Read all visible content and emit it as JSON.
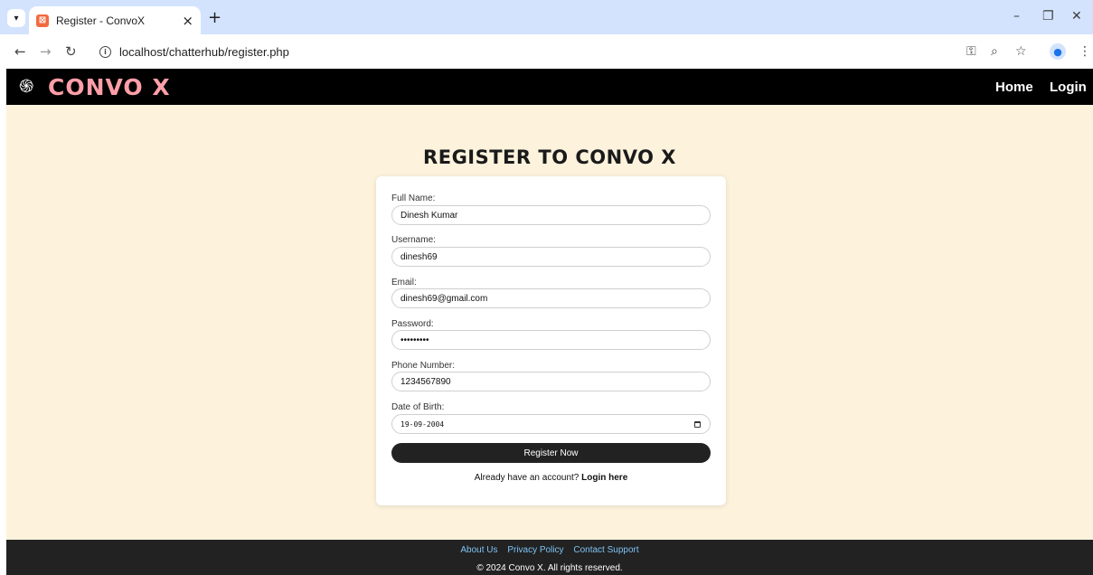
{
  "browser": {
    "tab_title": "Register - ConvoX",
    "url": "localhost/chatterhub/register.php"
  },
  "site": {
    "logo_text": "CONVO X",
    "nav": [
      "Home",
      "Login"
    ]
  },
  "form": {
    "title": "REGISTER TO CONVO X",
    "fields": [
      {
        "label": "Full Name:",
        "value": "Dinesh Kumar"
      },
      {
        "label": "Username:",
        "value": "dinesh69"
      },
      {
        "label": "Email:",
        "value": "dinesh69@gmail.com"
      },
      {
        "label": "Password:",
        "value": "Password1"
      },
      {
        "label": "Phone Number:",
        "value": "1234567890"
      },
      {
        "label": "Date of Birth:",
        "value": "19-09-2004"
      }
    ],
    "submit_label": "Register Now",
    "login_prompt": "Already have an account?",
    "login_link": "Login here"
  },
  "footer": {
    "links": [
      "About Us",
      "Privacy Policy",
      "Contact Support"
    ],
    "copyright": "© 2024 Convo X. All rights reserved."
  },
  "colors": {
    "page_bg": "#fdf3dd",
    "header_bg": "#000000",
    "logo": "#ff9ea8",
    "footer_bg": "#222222",
    "footer_link": "#7ec3f5",
    "button_bg": "#222222"
  },
  "icons": [
    "tab-search-icon",
    "favicon-icon",
    "close-tab-icon",
    "new-tab-icon",
    "minimize-icon",
    "restore-icon",
    "close-window-icon",
    "back-icon",
    "forward-icon",
    "reload-icon",
    "site-info-icon",
    "password-key-icon",
    "zoom-icon",
    "bookmark-star-icon",
    "profile-icon",
    "menu-icon",
    "logo-icon",
    "calendar-icon"
  ]
}
